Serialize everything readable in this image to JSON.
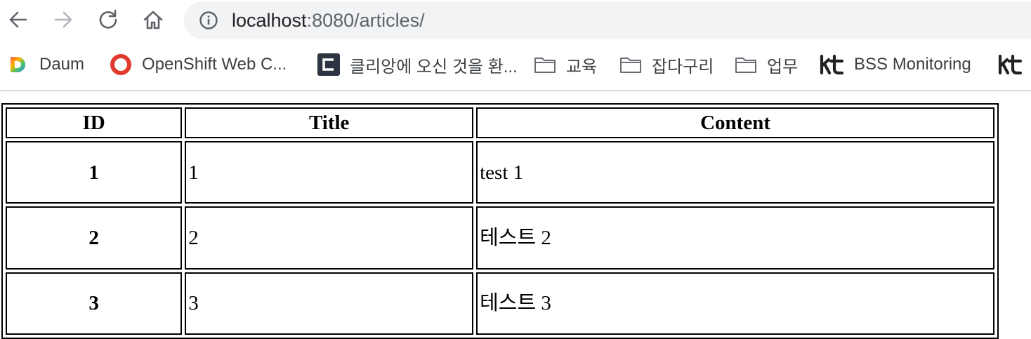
{
  "browser": {
    "url_host": "localhost",
    "url_rest": ":8080/articles/"
  },
  "bookmarks": [
    {
      "label": "Daum",
      "icon": "daum-icon"
    },
    {
      "label": "OpenShift Web C...",
      "icon": "openshift-icon"
    },
    {
      "label": "클리앙에 오신 것을 환...",
      "icon": "clien-icon"
    },
    {
      "label": "교육",
      "icon": "folder-icon"
    },
    {
      "label": "잡다구리",
      "icon": "folder-icon"
    },
    {
      "label": "업무",
      "icon": "folder-icon"
    },
    {
      "label": "BSS Monitoring",
      "icon": "kt-icon"
    },
    {
      "label": "",
      "icon": "kt-icon"
    }
  ],
  "table": {
    "headers": [
      "ID",
      "Title",
      "Content"
    ],
    "rows": [
      {
        "id": "1",
        "title": "1",
        "content": "test 1"
      },
      {
        "id": "2",
        "title": "2",
        "content": "테스트 2"
      },
      {
        "id": "3",
        "title": "3",
        "content": "테스트 3"
      }
    ]
  }
}
